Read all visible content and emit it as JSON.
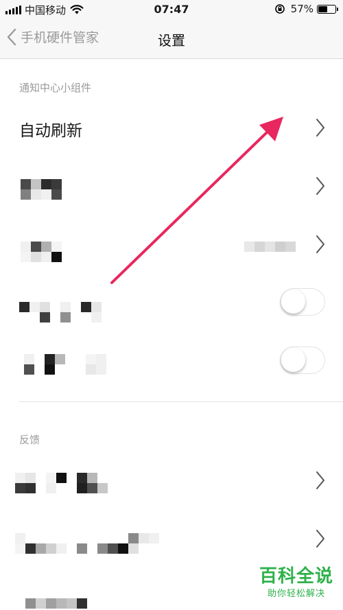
{
  "status_bar": {
    "carrier": "中国移动",
    "time": "07:47",
    "battery_percent_label": "57%",
    "battery_level": 0.57
  },
  "nav": {
    "back_label": "手机硬件管家",
    "title": "设置"
  },
  "sections": [
    {
      "header": "通知中心小组件",
      "rows": [
        {
          "label": "自动刷新",
          "control": "chevron"
        },
        {
          "label": "",
          "control": "chevron",
          "obscured": true
        },
        {
          "label": "",
          "control": "chevron",
          "obscured": true,
          "value_obscured": true
        },
        {
          "label": "",
          "control": "toggle",
          "toggle_on": false,
          "obscured": true
        },
        {
          "label": "",
          "control": "toggle",
          "toggle_on": false,
          "obscured": true
        }
      ]
    },
    {
      "header": "反馈",
      "rows": [
        {
          "label": "",
          "control": "chevron",
          "obscured": true
        },
        {
          "label": "",
          "control": "chevron",
          "obscured": true
        },
        {
          "label": "",
          "control": "chevron",
          "obscured": true
        }
      ]
    }
  ],
  "annotation": {
    "arrow_color": "#e8275e"
  },
  "watermark": {
    "main": "百科全说",
    "sub": "助你轻松解决"
  },
  "colors": {
    "accent_watermark": "#2fb14b",
    "section_header": "#9a9a9a",
    "nav_bg": "#f7f7f7"
  }
}
